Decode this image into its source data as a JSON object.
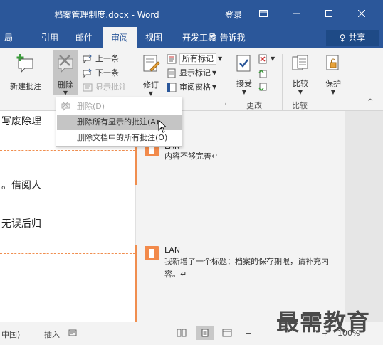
{
  "window": {
    "title": "档案管理制度.docx - Word",
    "login": "登录",
    "controls": [
      "ribbon-display-icon",
      "minimize-icon",
      "maximize-icon",
      "close-icon"
    ]
  },
  "tabs": [
    {
      "label": "局",
      "active": false
    },
    {
      "label": "引用",
      "active": false
    },
    {
      "label": "邮件",
      "active": false
    },
    {
      "label": "审阅",
      "active": true
    },
    {
      "label": "视图",
      "active": false
    },
    {
      "label": "开发工具",
      "active": false
    }
  ],
  "tellme": "♀ 告诉我",
  "share": "♀ 共享",
  "ribbon": {
    "new_comment": "新建批注",
    "delete": "删除",
    "prev": "上一条",
    "next": "下一条",
    "show_comments": "显示批注",
    "track_changes": "修订",
    "all_markup": "所有标记",
    "show_markup": "显示标记",
    "review_pane": "审阅窗格",
    "accept": "接受",
    "compare": "比较",
    "protect": "保护",
    "group_changes": "更改",
    "group_compare": "比较"
  },
  "menu": {
    "items": [
      {
        "label": "删除(D)",
        "state": "disabled"
      },
      {
        "label": "删除所有显示的批注(A)",
        "state": "highlighted"
      },
      {
        "label": "删除文档中的所有批注(O)",
        "state": "normal"
      }
    ]
  },
  "document": {
    "lines": [
      "写废除理",
      "。借阅人",
      "无误后归"
    ]
  },
  "comments": [
    {
      "author": "LAN",
      "text": "内容不够完善↵"
    },
    {
      "author": "LAN",
      "text_line1": "我新增了一个标题：档案的保存期限，请补充内",
      "text_line2": "容。↵"
    }
  ],
  "status": {
    "lang": "中国)",
    "insert": "插入",
    "zoom": "100%"
  },
  "watermark": "最需教育",
  "colors": {
    "accent": "#2b579a",
    "comment": "#f08e4f"
  }
}
